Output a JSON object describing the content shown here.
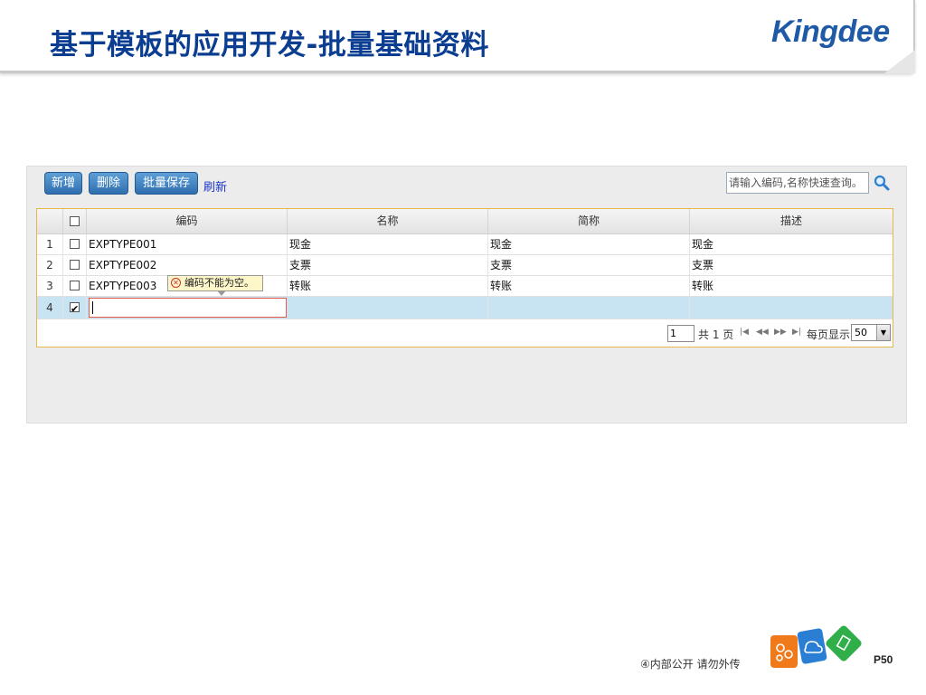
{
  "slide": {
    "title": "基于模板的应用开发-批量基础资料",
    "logo_text": "Kingdee"
  },
  "toolbar": {
    "add_label": "新增",
    "delete_label": "删除",
    "batch_save_label": "批量保存",
    "refresh_label": "刷新"
  },
  "search": {
    "placeholder": "请输入编码,名称快速查询。",
    "icon": "search-icon"
  },
  "grid": {
    "columns": [
      "编码",
      "名称",
      "简称",
      "描述"
    ],
    "rows": [
      {
        "num": "1",
        "checked": false,
        "code": "EXPTYPE001",
        "name": "现金",
        "short": "现金",
        "desc": "现金"
      },
      {
        "num": "2",
        "checked": false,
        "code": "EXPTYPE002",
        "name": "支票",
        "short": "支票",
        "desc": "支票"
      },
      {
        "num": "3",
        "checked": false,
        "code": "EXPTYPE003",
        "name": "转账",
        "short": "转账",
        "desc": "转账"
      },
      {
        "num": "4",
        "checked": true,
        "code": "",
        "name": "",
        "short": "",
        "desc": ""
      }
    ],
    "validation_message": "编码不能为空。",
    "accent_border": "#e8b74a",
    "selected_row_color": "#c8e3f2"
  },
  "pager": {
    "current_page": "1",
    "total_text": "共 1 页",
    "per_page_label": "每页显示",
    "per_page_value": "50"
  },
  "footer": {
    "note": "④内部公开 请勿外传",
    "page_number": "P50"
  },
  "colors": {
    "title": "#0b3d91",
    "button": "#2f6fb0",
    "link": "#1a35c7"
  }
}
